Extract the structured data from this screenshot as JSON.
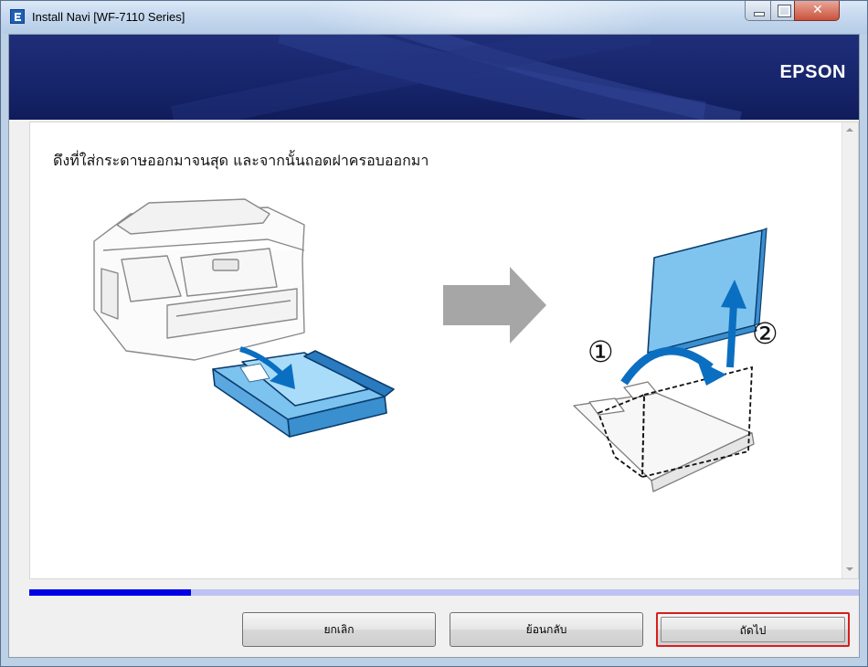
{
  "window": {
    "title": "Install Navi [WF-7110 Series]",
    "icon": "epson-app-icon",
    "controls": [
      "minimize-icon",
      "maximize-icon",
      "close-icon"
    ]
  },
  "banner": {
    "logo": "EPSON",
    "color": "#16246a"
  },
  "content": {
    "instruction": "ดึงที่ใส่กระดาษออกมาจนสุด และจากนั้นถอดฝาครอบออกมา",
    "illustration": {
      "step_marks": [
        "①",
        "②"
      ],
      "arrow_color": "#a6a6a6",
      "accent_color": "#0b6fc1"
    }
  },
  "progress": {
    "value": 0.195,
    "fill_color": "#0000e6",
    "track_color": "#bcc3f2"
  },
  "buttons": {
    "cancel": "ยกเลิก",
    "back": "ย้อนกลับ",
    "next": "ถัดไป",
    "highlight_color": "#d81e1e"
  }
}
